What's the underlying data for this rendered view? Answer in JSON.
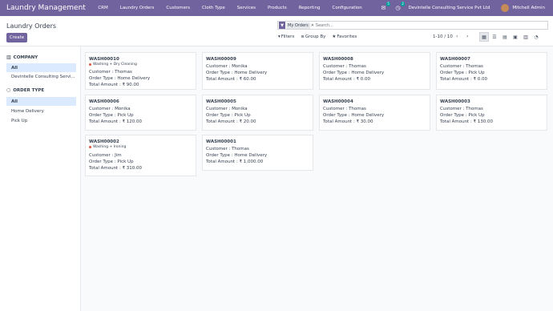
{
  "app": {
    "brand": "Laundry Management",
    "menu": [
      "CRM",
      "Laundry Orders",
      "Customers",
      "Cloth Type",
      "Services",
      "Products",
      "Reporting",
      "Configuration"
    ],
    "messages_count": "5",
    "activities_count": "2",
    "company": "Devintelle Consulting Service Pvt Ltd",
    "user": "Mitchell Admin"
  },
  "control": {
    "title": "Laundry Orders",
    "create_label": "Create",
    "search_facet": "My Orders",
    "search_placeholder": "Search...",
    "filters_label": "Filters",
    "groupby_label": "Group By",
    "favorites_label": "Favorites",
    "pager": "1-10 / 10"
  },
  "sidebar": {
    "company_header": "COMPANY",
    "company_items": [
      "All",
      "Devintelle Consulting Servi..."
    ],
    "ordertype_header": "ORDER TYPE",
    "ordertype_items": [
      "All",
      "Home Delivery",
      "Pick Up"
    ]
  },
  "cards": [
    {
      "name": "WASH00010",
      "tag": "Washing + Dry Cleaning",
      "customer": "Customer : Thomas",
      "order_type": "Order Type : Home Delivery",
      "total": "Total Amount : ₹ 90.00"
    },
    {
      "name": "WASH00009",
      "tag": "",
      "customer": "Customer : Monika",
      "order_type": "Order Type : Home Delivery",
      "total": "Total Amount : ₹ 60.00"
    },
    {
      "name": "WASH00008",
      "tag": "",
      "customer": "Customer : Thomas",
      "order_type": "Order Type : Home Delivery",
      "total": "Total Amount : ₹ 0.00"
    },
    {
      "name": "WASH00007",
      "tag": "",
      "customer": "Customer : Thomas",
      "order_type": "Order Type : Pick Up",
      "total": "Total Amount : ₹ 0.00"
    },
    {
      "name": "WASH00006",
      "tag": "",
      "customer": "Customer : Monika",
      "order_type": "Order Type : Pick Up",
      "total": "Total Amount : ₹ 120.00"
    },
    {
      "name": "WASH00005",
      "tag": "",
      "customer": "Customer : Monika",
      "order_type": "Order Type : Pick Up",
      "total": "Total Amount : ₹ 20.00"
    },
    {
      "name": "WASH00004",
      "tag": "",
      "customer": "Customer : Thomas",
      "order_type": "Order Type : Home Delivery",
      "total": "Total Amount : ₹ 30.00"
    },
    {
      "name": "WASH00003",
      "tag": "",
      "customer": "Customer : Thomas",
      "order_type": "Order Type : Pick Up",
      "total": "Total Amount : ₹ 130.00"
    },
    {
      "name": "WASH00002",
      "tag": "Washing + Ironing",
      "customer": "Customer : Jim",
      "order_type": "Order Type : Pick Up",
      "total": "Total Amount : ₹ 310.00"
    },
    {
      "name": "WASH00001",
      "tag": "",
      "customer": "Customer : Thomas",
      "order_type": "Order Type : Home Delivery",
      "total": "Total Amount : ₹ 1,000.00"
    }
  ]
}
